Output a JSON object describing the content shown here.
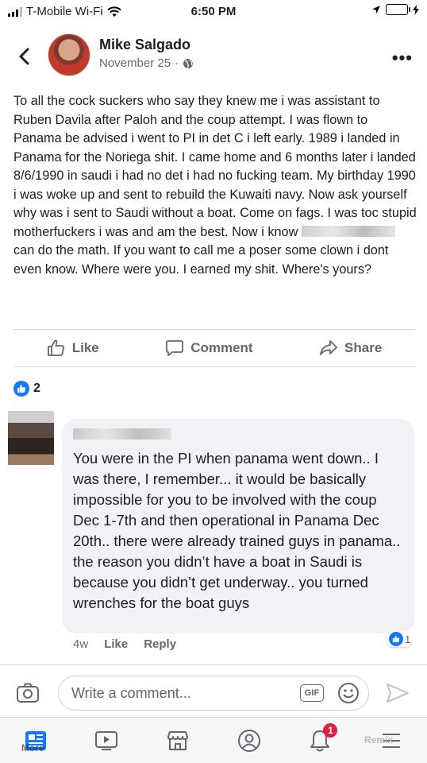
{
  "status_bar": {
    "carrier": "T-Mobile Wi-Fi",
    "time": "6:50 PM"
  },
  "post": {
    "author": "Mike Salgado",
    "date": "November 25",
    "separator": "·",
    "text_part1": "To all the cock suckers who say they knew me i was assistant to Ruben Davila after Paloh and the coup attempt. I was flown to Panama be advised i went to PI in det C i left early. 1989 i landed in Panama for the Noriega shit. I came home and 6 months later i landed 8/6/1990  in saudi i had no det i had no fucking team. My birthday 1990 i was woke up and sent to rebuild  the Kuwaiti navy. Now ask yourself why was i sent to Saudi without a boat. Come on fags. I was toc stupid motherfuckers i was and am the best. Now i know ",
    "text_part2": " can do the math.  If you want to call me a poser some clown i dont even know. Where were you. I earned my shit. Where's yours?"
  },
  "actions": {
    "like": "Like",
    "comment": "Comment",
    "share": "Share"
  },
  "reactions": {
    "count": "2"
  },
  "comment": {
    "text": "You were in the PI when panama went down.. I was there, I remember... it would be basically impossible for you to be involved with the coup Dec 1-7th and then operational in Panama Dec 20th.. there were already trained guys in panama.. the reason you didn’t have a boat in Saudi is because you didn’t get underway.. you turned wrenches for the boat guys",
    "age": "4w",
    "like_label": "Like",
    "reply_label": "Reply",
    "reaction_count": "1"
  },
  "composer": {
    "placeholder": "Write a comment...",
    "gif_label": "GIF"
  },
  "tabbar": {
    "notifications_badge": "1",
    "more_overlay": "More",
    "right_overlay": "Remix"
  },
  "colors": {
    "accent": "#1877f2",
    "badge": "#e41e3f",
    "muted": "#65676b"
  }
}
